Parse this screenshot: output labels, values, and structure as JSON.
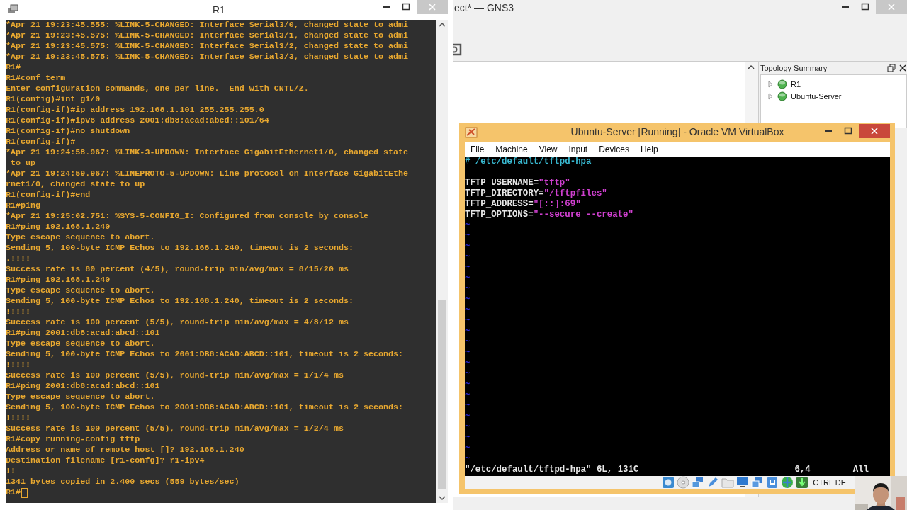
{
  "terminal_window": {
    "title": "R1",
    "lines": [
      "*Apr 21 19:23:45.555: %LINK-5-CHANGED: Interface Serial3/0, changed state to admi",
      "*Apr 21 19:23:45.575: %LINK-5-CHANGED: Interface Serial3/1, changed state to admi",
      "*Apr 21 19:23:45.575: %LINK-5-CHANGED: Interface Serial3/2, changed state to admi",
      "*Apr 21 19:23:45.575: %LINK-5-CHANGED: Interface Serial3/3, changed state to admi",
      "R1#",
      "R1#conf term",
      "Enter configuration commands, one per line.  End with CNTL/Z.",
      "R1(config)#int g1/0",
      "R1(config-if)#ip address 192.168.1.101 255.255.255.0",
      "R1(config-if)#ipv6 address 2001:db8:acad:abcd::101/64",
      "R1(config-if)#no shutdown",
      "R1(config-if)#",
      "*Apr 21 19:24:58.967: %LINK-3-UPDOWN: Interface GigabitEthernet1/0, changed state",
      " to up",
      "*Apr 21 19:24:59.967: %LINEPROTO-5-UPDOWN: Line protocol on Interface GigabitEthe",
      "rnet1/0, changed state to up",
      "R1(config-if)#end",
      "R1#ping",
      "*Apr 21 19:25:02.751: %SYS-5-CONFIG_I: Configured from console by console",
      "R1#ping 192.168.1.240",
      "Type escape sequence to abort.",
      "Sending 5, 100-byte ICMP Echos to 192.168.1.240, timeout is 2 seconds:",
      ".!!!!",
      "Success rate is 80 percent (4/5), round-trip min/avg/max = 8/15/20 ms",
      "R1#ping 192.168.1.240",
      "Type escape sequence to abort.",
      "Sending 5, 100-byte ICMP Echos to 192.168.1.240, timeout is 2 seconds:",
      "!!!!!",
      "Success rate is 100 percent (5/5), round-trip min/avg/max = 4/8/12 ms",
      "R1#ping 2001:db8:acad:abcd::101",
      "Type escape sequence to abort.",
      "Sending 5, 100-byte ICMP Echos to 2001:DB8:ACAD:ABCD::101, timeout is 2 seconds:",
      "!!!!!",
      "Success rate is 100 percent (5/5), round-trip min/avg/max = 1/1/4 ms",
      "R1#ping 2001:db8:acad:abcd::101",
      "Type escape sequence to abort.",
      "Sending 5, 100-byte ICMP Echos to 2001:DB8:ACAD:ABCD::101, timeout is 2 seconds:",
      "!!!!!",
      "Success rate is 100 percent (5/5), round-trip min/avg/max = 1/2/4 ms",
      "R1#copy running-config tftp",
      "Address or name of remote host []? 192.168.1.240",
      "Destination filename [r1-confg]? r1-ipv4",
      "!!",
      "1341 bytes copied in 2.400 secs (559 bytes/sec)",
      "R1#"
    ]
  },
  "gns3_window": {
    "title": "ect* — GNS3",
    "topology_summary": {
      "title": "Topology Summary",
      "items": [
        {
          "label": "R1",
          "expanded": false,
          "running": true
        },
        {
          "label": "Ubuntu-Server",
          "expanded": false,
          "running": true
        }
      ]
    }
  },
  "virtualbox_window": {
    "title": "Ubuntu-Server [Running] - Oracle VM VirtualBox",
    "menu": [
      "File",
      "Machine",
      "View",
      "Input",
      "Devices",
      "Help"
    ],
    "editor": {
      "comment": "# /etc/default/tftpd-hpa",
      "settings": [
        {
          "name": "TFTP_USERNAME=",
          "value": "\"tftp\""
        },
        {
          "name": "TFTP_DIRECTORY=",
          "value": "\"/tftpfiles\""
        },
        {
          "name": "TFTP_ADDRESS=",
          "value": "\"[::]:69\""
        },
        {
          "name": "TFTP_OPTIONS=",
          "value": "\"--secure --create\""
        }
      ],
      "empty_lines": [
        "~",
        "~",
        "~",
        "~",
        "~",
        "~",
        "~",
        "~",
        "~",
        "~",
        "~",
        "~",
        "~",
        "~",
        "~",
        "~",
        "~",
        "~",
        "~",
        "~",
        "~",
        "~",
        "~"
      ],
      "file_info": "\"/etc/default/tftpd-hpa\" 6L, 131C",
      "cursor": "6,4",
      "position": "All"
    },
    "host_key": "CTRL DE"
  }
}
